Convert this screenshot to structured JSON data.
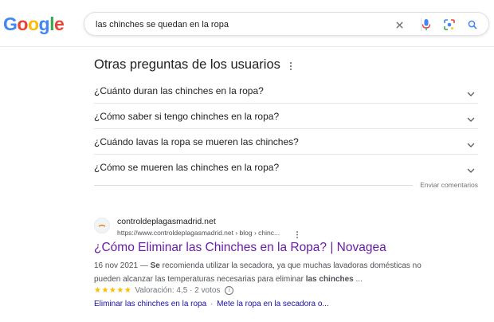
{
  "header": {
    "logo": {
      "letters": [
        "G",
        "o",
        "o",
        "g",
        "l",
        "e"
      ],
      "colors": [
        "#4285f4",
        "#ea4335",
        "#fbbc05",
        "#4285f4",
        "#34a853",
        "#ea4335"
      ]
    },
    "search": {
      "query": "las chinches se quedan en la ropa"
    },
    "icons": [
      "clear-icon",
      "mic-icon",
      "lens-icon",
      "search-icon"
    ]
  },
  "people_also_ask": {
    "title": "Otras preguntas de los usuarios",
    "questions": [
      "¿Cuánto duran las chinches en la ropa?",
      "¿Cómo saber si tengo chinches en la ropa?",
      "¿Cuándo lavas la ropa se mueren las chinches?",
      "¿Cómo se mueren las chinches en la ropa?"
    ],
    "feedback": "Enviar comentarios"
  },
  "result": {
    "site_name": "controldeplagasmadrid.net",
    "url": "https://www.controldeplagasmadrid.net › blog › chinc...",
    "title": "¿Cómo Eliminar las Chinches en la Ropa? | Novagea",
    "snippet": {
      "date": "16 nov 2021",
      "dash": " — ",
      "bold1": "Se",
      "text1": " recomienda utilizar la secadora, ya que muchas lavadoras domésticas no pueden alcanzar las temperaturas necesarias para eliminar ",
      "bold2": "las chinches",
      "text2": " ..."
    },
    "rating": {
      "stars": "★★★★★",
      "value": 4.5,
      "text": "Valoración: 4,5 · 2 votos"
    },
    "sitelinks": [
      "Eliminar las chinches en la ropa",
      "Mete la ropa en la secadora o..."
    ],
    "sitelink_sep": "·",
    "colors": {
      "title_visited": "#681da8",
      "link": "#1a0dab",
      "star": "#fbbc04"
    }
  }
}
